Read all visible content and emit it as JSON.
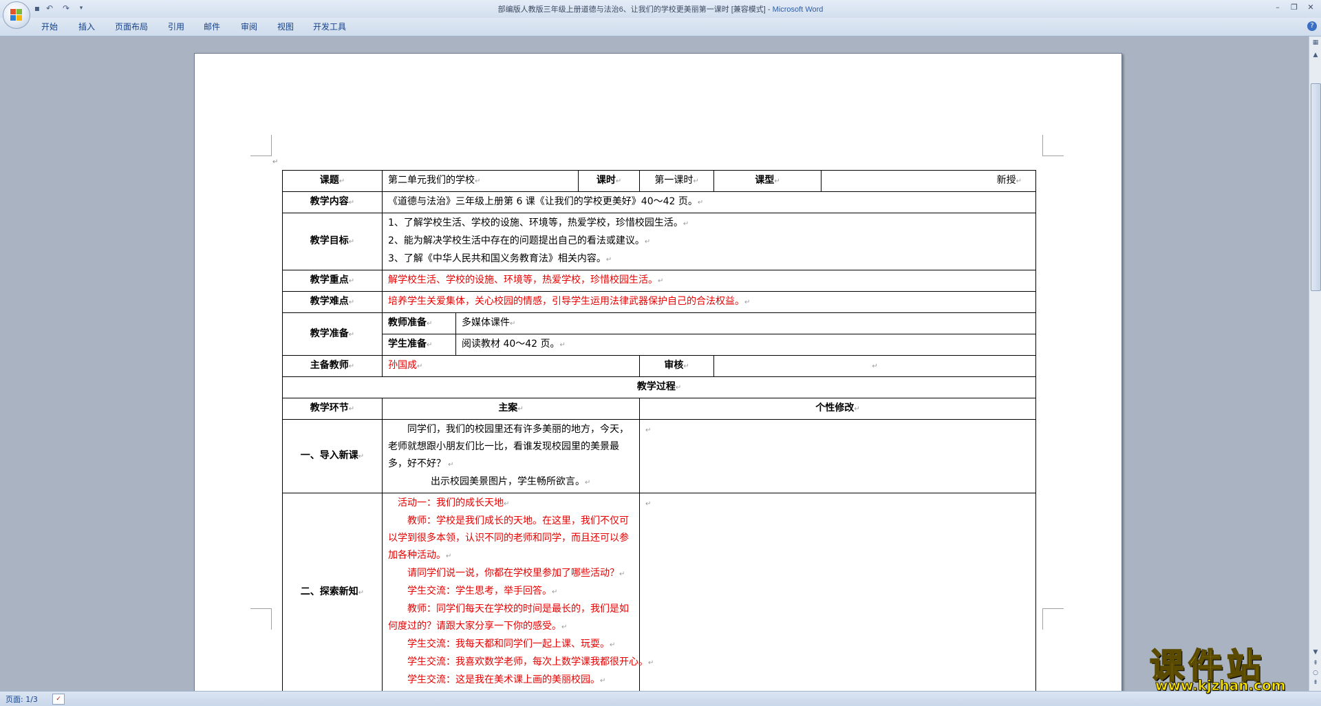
{
  "window": {
    "title": "部编版人教版三年级上册道德与法治6、让我们的学校更美丽第一课时 [兼容模式]",
    "app": "Microsoft Word",
    "separator": " - "
  },
  "ribbon": {
    "tabs": [
      "开始",
      "插入",
      "页面布局",
      "引用",
      "邮件",
      "审阅",
      "视图",
      "开发工具"
    ]
  },
  "icons": {
    "office_button": "office-logo-icon",
    "save": "save-icon",
    "undo": "undo-icon",
    "redo": "redo-icon",
    "help": "help-icon"
  },
  "colors": {
    "accent_red": "#e60000",
    "ribbon_text": "#15428b",
    "watermark": "#ffe900"
  },
  "table": {
    "topic_label": "课题",
    "topic_value": "第二单元我们的学校",
    "period_label": "课时",
    "period_value": "第一课时",
    "type_label": "课型",
    "type_value": "新授",
    "content_label": "教学内容",
    "content_value": "《道德与法治》三年级上册第 6 课《让我们的学校更美好》40～42 页。",
    "goals_label": "教学目标",
    "goals": [
      "1、了解学校生活、学校的设施、环境等，热爱学校，珍惜校园生活。",
      "2、能为解决学校生活中存在的问题提出自己的看法或建议。",
      "3、了解《中华人民共和国义务教育法》相关内容。"
    ],
    "key_label": "教学重点",
    "key_value": "解学校生活、学校的设施、环境等，热爱学校，珍惜校园生活。",
    "difficulty_label": "教学难点",
    "difficulty_value": "培养学生关爱集体，关心校园的情感，引导学生运用法律武器保护自己的合法权益。",
    "prep_label": "教学准备",
    "teacher_prep_label": "教师准备",
    "teacher_prep_value": "多媒体课件",
    "student_prep_label": "学生准备",
    "student_prep_value": "阅读教材 40～42 页。",
    "lead_teacher_label": "主备教师",
    "lead_teacher_value": "孙国成",
    "review_label": "审核",
    "process_header": "教学过程",
    "col_stage": "教学环节",
    "col_plan": "主案",
    "col_personal": "个性修改",
    "stage1_label": "一、导入新课",
    "stage1_lines": [
      "同学们，我们的校园里还有许多美丽的地方，今天，老师就想跟小朋友们比一比，看谁发现校园里的美景最多，好不好？",
      "出示校园美景图片，学生畅所欲言。"
    ],
    "stage2_label": "二、探索新知",
    "stage2_lines": [
      "活动一：我们的成长天地",
      "教师：学校是我们成长的天地。在这里，我们不仅可以学到很多本领，认识不同的老师和同学，而且还可以参加各种活动。",
      "请同学们说一说，你都在学校里参加了哪些活动？",
      "学生交流：学生思考，举手回答。",
      "教师：同学们每天在学校的时间是最长的，我们是如何度过的？请跟大家分享一下你的感受。",
      "学生交流：我每天都和同学们一起上课、玩耍。",
      "学生交流：我喜欢数学老师，每次上数学课我都很开心。",
      "学生交流：这是我在美术课上画的美丽校园。"
    ]
  },
  "status": {
    "page": "页面: 1/3"
  },
  "watermark": {
    "brand": "课件站",
    "url": "www.kjzhan.com"
  }
}
